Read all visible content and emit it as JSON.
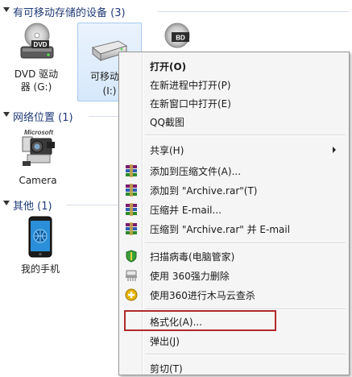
{
  "groups": {
    "removable": {
      "title": "有可移动存储的设备 (3)"
    },
    "network": {
      "title": "网络位置 (1)"
    },
    "other": {
      "title": "其他 (1)"
    }
  },
  "devices": {
    "dvd": {
      "label1": "DVD 驱动",
      "label2": "器 (G:)",
      "badge": "DVD"
    },
    "removable": {
      "label1": "可移动磁",
      "label2": "(I:)"
    },
    "bd": {
      "badge": "BD"
    },
    "camera": {
      "label": "Camera",
      "brand": "Microsoft"
    },
    "phone": {
      "label": "我的手机"
    }
  },
  "menu": {
    "items": [
      {
        "label": "打开(O)",
        "bold": true
      },
      {
        "label": "在新进程中打开(P)"
      },
      {
        "label": "在新窗口中打开(E)"
      },
      {
        "label": "QQ截图"
      },
      {
        "label": "共享(H)",
        "submenu": true
      },
      {
        "label": "添加到压缩文件(A)...",
        "icon": "winrar-icon"
      },
      {
        "label": "添加到 \"Archive.rar\"(T)",
        "icon": "winrar-icon"
      },
      {
        "label": "压缩并 E-mail...",
        "icon": "winrar-icon"
      },
      {
        "label": "压缩到 \"Archive.rar\" 并 E-mail",
        "icon": "winrar-icon"
      },
      {
        "label": "扫描病毒(电脑管家)",
        "icon": "shield-icon"
      },
      {
        "label": "使用 360强力删除",
        "icon": "shredder-icon"
      },
      {
        "label": "使用360进行木马云查杀",
        "icon": "plus-icon"
      },
      {
        "label": "格式化(A)..."
      },
      {
        "label": "弹出(J)"
      },
      {
        "label": "剪切(T)"
      }
    ]
  },
  "colors": {
    "highlight_border": "#b0292a",
    "group_title": "#1f3a78"
  }
}
